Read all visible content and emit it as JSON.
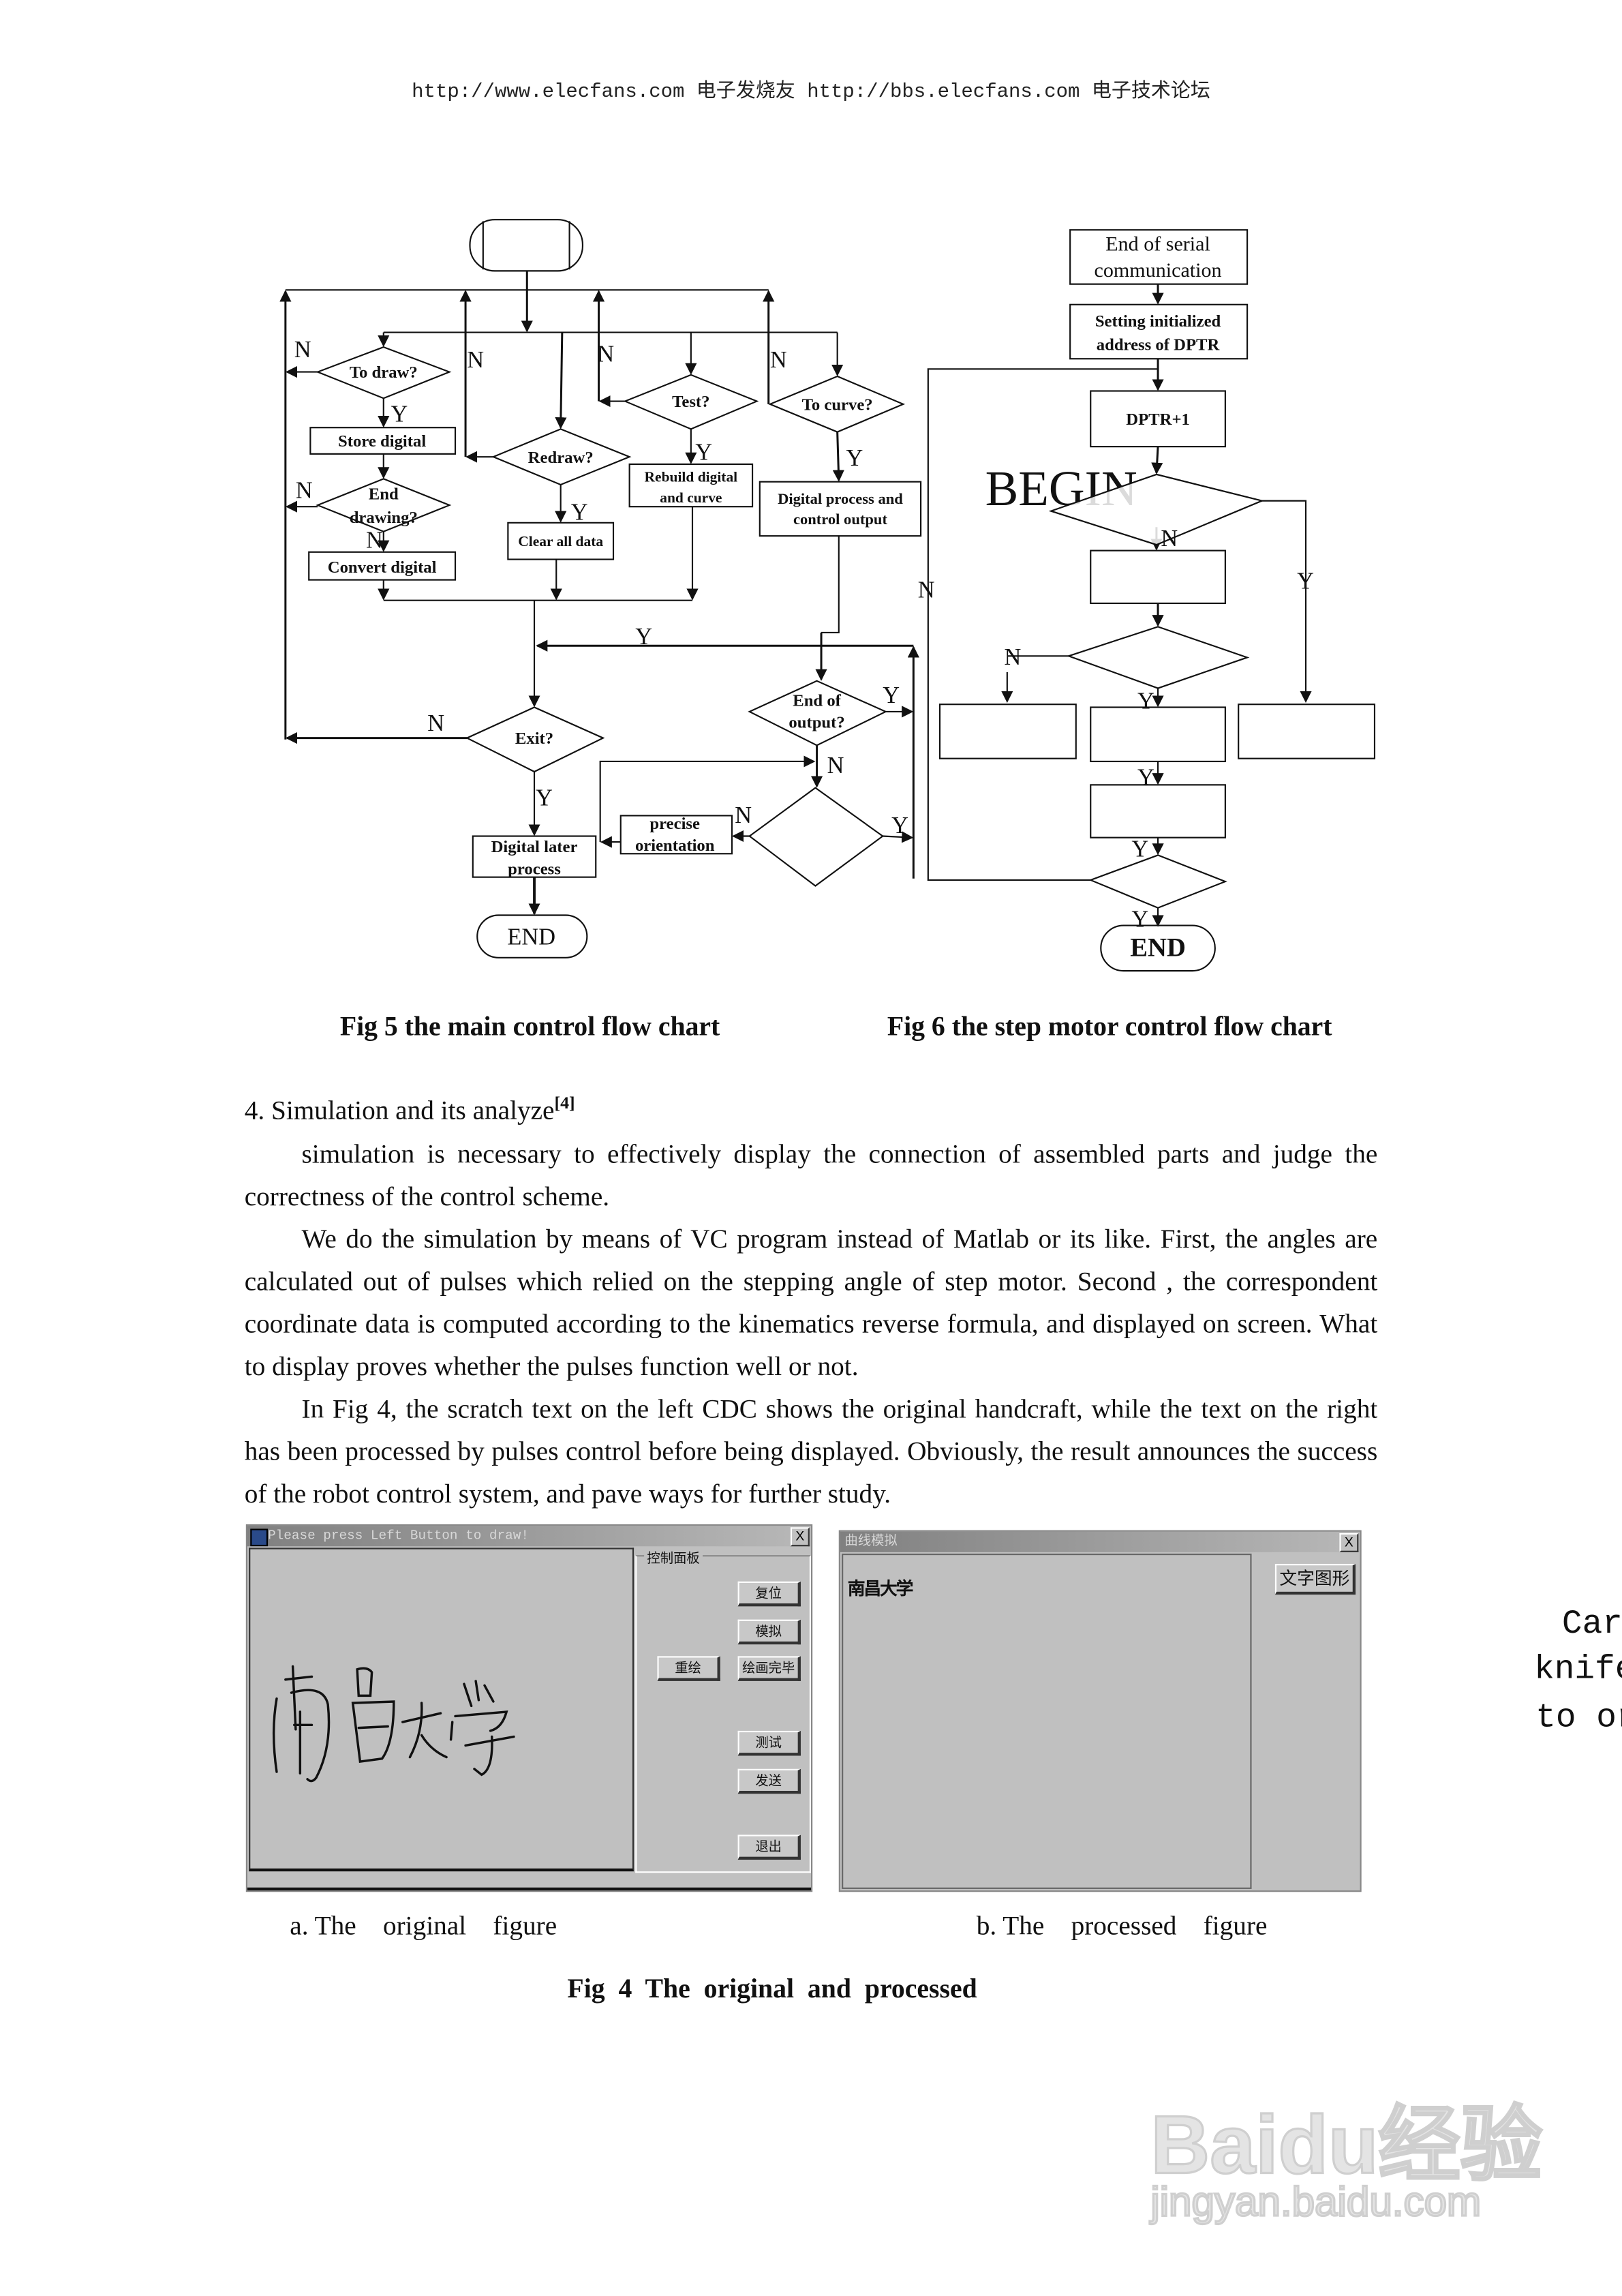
{
  "header": {
    "text": "http://www.elecfans.com 电子发烧友 http://bbs.elecfans.com 电子技术论坛"
  },
  "fig5": {
    "caption": "Fig 5 the main control flow chart",
    "to_draw": "To draw?",
    "store_digital": "Store digital",
    "end_drawing": [
      "End",
      "drawing?"
    ],
    "convert_digital": "Convert digital",
    "redraw": "Redraw?",
    "clear_all_data": "Clear all data",
    "test": "Test?",
    "rebuild": [
      "Rebuild digital",
      "and curve"
    ],
    "to_curve": "To curve?",
    "digital_process": [
      "Digital process and",
      "control output"
    ],
    "end_of_output": [
      "End of",
      "output?"
    ],
    "exit": "Exit?",
    "precise_orientation": [
      "precise",
      "orientation"
    ],
    "digital_later": [
      "Digital later",
      "process"
    ],
    "end": "END",
    "yes": "Y",
    "no": "N"
  },
  "fig6": {
    "caption": "Fig 6 the step motor control flow chart",
    "end_serial": [
      "End of serial",
      "communication"
    ],
    "setting": [
      "Setting initialized",
      "address of DPTR"
    ],
    "dptr": "DPTR+1",
    "begin": "BEGIN",
    "end": "END",
    "yes": "Y",
    "no": "N"
  },
  "section": {
    "title": "4. Simulation and its analyze",
    "ref": "[4]"
  },
  "paragraphs": [
    "simulation is necessary to effectively display the connection of assembled parts and judge the correctness of the control scheme.",
    "We do the simulation by means of VC program instead of Matlab or its like. First, the angles are calculated out of pulses which relied on the stepping angle of step motor. Second , the correspondent coordinate data is computed according to the kinematics reverse formula, and displayed on screen. What to display proves whether the pulses function well or not.",
    "In Fig 4, the scratch text on the left CDC shows the original handcraft, while the text on the right has been processed by pulses control before being displayed. Obviously, the result announces the success of the robot control system, and pave ways for further study."
  ],
  "window_a": {
    "title": "Please press Left Button to draw!",
    "close": "X",
    "group": "控制面板",
    "handwriting": "南昌大学",
    "buttons": {
      "reset": "复位",
      "simulate": "模拟",
      "redraw": "重绘",
      "finish": "绘画完毕",
      "test": "测试",
      "send": "发送",
      "exit": "退出"
    }
  },
  "window_b": {
    "title": "曲线模拟",
    "close": "X",
    "output_text": "南昌大学",
    "button": "文字图形"
  },
  "fig4": {
    "sub_a": "a. The    original    figure",
    "sub_b": "b. The    processed    figure",
    "caption": "Fig  4  The  original  and  processed"
  },
  "cut_text": [
    "Car",
    "knife",
    "to or"
  ],
  "watermark": {
    "brand": "Baidu经验",
    "url": "jingyan.baidu.com"
  }
}
